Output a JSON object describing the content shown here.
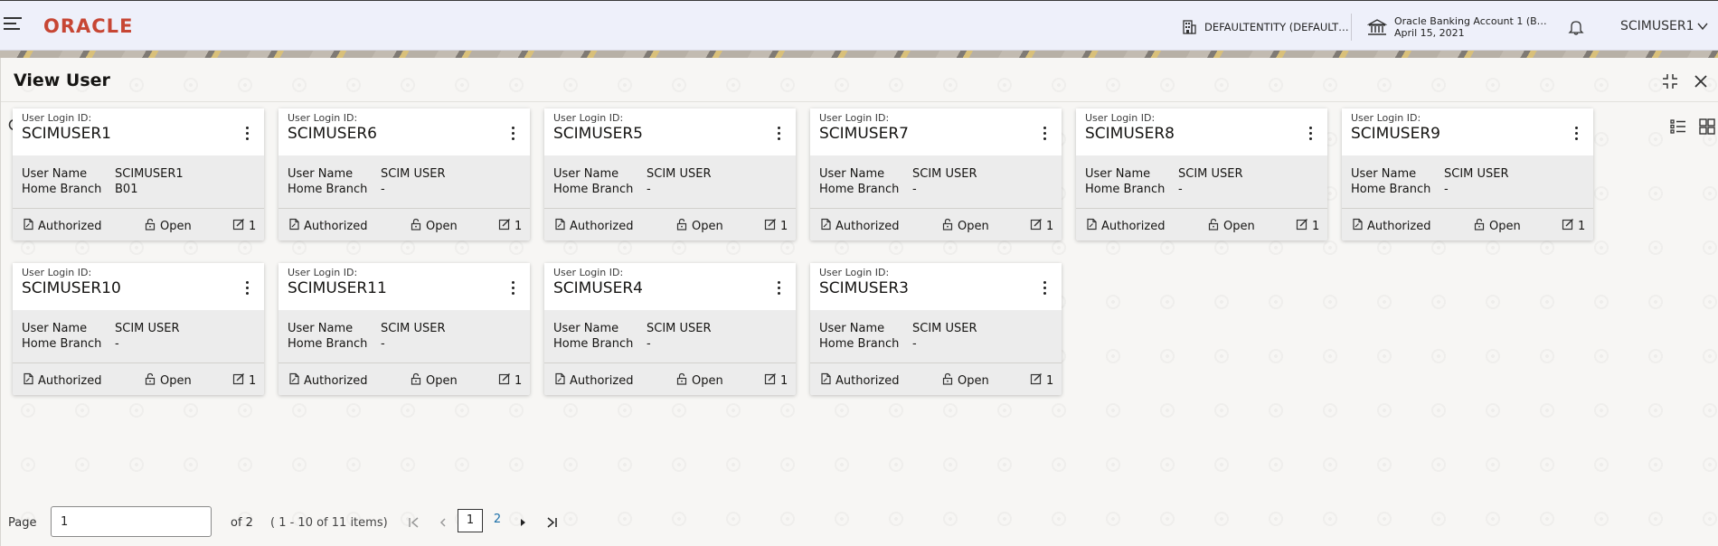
{
  "header": {
    "logo": "ORACLE",
    "entity": "DEFAULTENTITY (DEFAULT…",
    "account_line1": "Oracle Banking Account 1 (B…",
    "account_line2": "April 15, 2021",
    "user": "SCIMUSER1"
  },
  "panel": {
    "title": "View User"
  },
  "labels": {
    "login_id": "User Login ID:",
    "user_name": "User Name",
    "home_branch": "Home Branch",
    "authorized": "Authorized",
    "open": "Open"
  },
  "cards": [
    {
      "id": "SCIMUSER1",
      "user_name": "SCIMUSER1",
      "home_branch": "B01",
      "status": "Authorized",
      "record": "Open",
      "count": "1"
    },
    {
      "id": "SCIMUSER6",
      "user_name": "SCIM USER",
      "home_branch": "-",
      "status": "Authorized",
      "record": "Open",
      "count": "1"
    },
    {
      "id": "SCIMUSER5",
      "user_name": "SCIM USER",
      "home_branch": "-",
      "status": "Authorized",
      "record": "Open",
      "count": "1"
    },
    {
      "id": "SCIMUSER7",
      "user_name": "SCIM USER",
      "home_branch": "-",
      "status": "Authorized",
      "record": "Open",
      "count": "1"
    },
    {
      "id": "SCIMUSER8",
      "user_name": "SCIM USER",
      "home_branch": "-",
      "status": "Authorized",
      "record": "Open",
      "count": "1"
    },
    {
      "id": "SCIMUSER9",
      "user_name": "SCIM USER",
      "home_branch": "-",
      "status": "Authorized",
      "record": "Open",
      "count": "1"
    },
    {
      "id": "SCIMUSER10",
      "user_name": "SCIM USER",
      "home_branch": "-",
      "status": "Authorized",
      "record": "Open",
      "count": "1"
    },
    {
      "id": "SCIMUSER11",
      "user_name": "SCIM USER",
      "home_branch": "-",
      "status": "Authorized",
      "record": "Open",
      "count": "1"
    },
    {
      "id": "SCIMUSER4",
      "user_name": "SCIM USER",
      "home_branch": "-",
      "status": "Authorized",
      "record": "Open",
      "count": "1"
    },
    {
      "id": "SCIMUSER3",
      "user_name": "SCIM USER",
      "home_branch": "-",
      "status": "Authorized",
      "record": "Open",
      "count": "1"
    }
  ],
  "pagination": {
    "page_label": "Page",
    "page_value": "1",
    "of_label": "of 2",
    "range": "( 1 - 10 of 11 items)",
    "pages": [
      "1",
      "2"
    ],
    "current": "1"
  }
}
